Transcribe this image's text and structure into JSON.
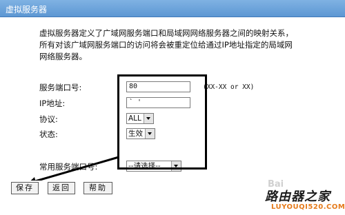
{
  "window": {
    "title": "虚拟服务器"
  },
  "description": {
    "lines": [
      "虚拟服务器定义了广域网服务端口和局域网网络服务器之间的映射关系，",
      "所有对该广域网服务端口的访问将会被重定位给通过IP地址指定的局域网",
      "网络服务器。"
    ]
  },
  "form": {
    "service_port_label": "服务端口号:",
    "service_port_value": "80",
    "service_port_hint": "(XX-XX or XX)",
    "ip_label": "IP地址:",
    "ip_value": "` ' ",
    "protocol_label": "协议:",
    "protocol_value": "ALL",
    "status_label": "状态:",
    "status_value": "生效",
    "common_port_label": "常用服务端口号:",
    "common_port_value": "--请选择--"
  },
  "buttons": {
    "save": "保存",
    "back": "返回",
    "help": "帮助"
  },
  "watermark": {
    "logo_text": "路由器之家",
    "url": "LUYOUQI520.COM",
    "baidu_text": "Bai"
  },
  "colors": {
    "titlebar": "#5d97d3",
    "title_text": "#ffffff",
    "url_text": "#e57a1a"
  }
}
